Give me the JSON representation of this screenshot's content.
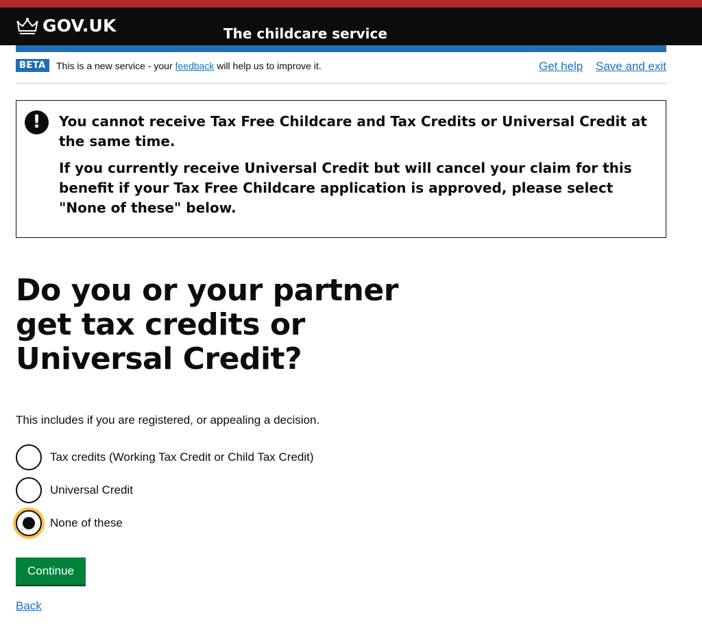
{
  "header": {
    "logo_text": "GOV.UK",
    "service_name": "The childcare service"
  },
  "phase_banner": {
    "tag": "BETA",
    "text_before": "This is a new service - your ",
    "feedback_link": "feedback",
    "text_after": " will help us to improve it.",
    "get_help": "Get help",
    "save_and_exit": "Save and exit"
  },
  "warning": {
    "icon": "!",
    "line1": "You cannot receive Tax Free Childcare and Tax Credits or Universal Credit at the same time.",
    "line2": "If you currently receive Universal Credit but will cancel your claim for this benefit if your Tax Free Childcare application is approved, please select \"None of these\" below."
  },
  "question": {
    "title": "Do you or your partner get tax credits or Universal Credit?",
    "hint": "This includes if you are registered, or appealing a decision.",
    "options": [
      {
        "label": "Tax credits (Working Tax Credit or Child Tax Credit)",
        "checked": false
      },
      {
        "label": "Universal Credit",
        "checked": false
      },
      {
        "label": "None of these",
        "checked": true
      }
    ]
  },
  "actions": {
    "continue_label": "Continue",
    "back_label": "Back"
  },
  "colors": {
    "topbar": "#b0282a",
    "header_bg": "#0b0c0c",
    "brand_blue": "#1d70b8",
    "button_green": "#00823b",
    "focus_yellow": "#ffbf47"
  }
}
